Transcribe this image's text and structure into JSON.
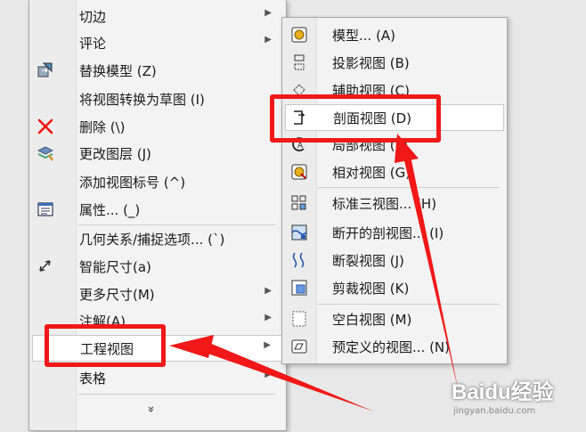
{
  "main_menu": {
    "items": [
      {
        "label": "切边",
        "icon": "",
        "submenu": true
      },
      {
        "label": "评论",
        "icon": "",
        "submenu": true
      },
      {
        "label": "替换模型 (Z)",
        "icon": "replace-model-icon",
        "submenu": false
      },
      {
        "label": "将视图转换为草图 (I)",
        "icon": "",
        "submenu": false
      },
      {
        "label": "删除 (\\)",
        "icon": "delete-x-icon",
        "submenu": false
      },
      {
        "label": "更改图层 (J)",
        "icon": "layers-icon",
        "submenu": false
      },
      {
        "label": "添加视图标号 (^)",
        "icon": "",
        "submenu": false
      },
      {
        "label": "属性... (_)",
        "icon": "properties-icon",
        "submenu": false
      },
      {
        "label": "几何关系/捕捉选项... (`)",
        "icon": "",
        "submenu": false
      },
      {
        "label": "智能尺寸(a)",
        "icon": "smart-dimension-icon",
        "submenu": false
      },
      {
        "label": "更多尺寸(M)",
        "icon": "",
        "submenu": true
      },
      {
        "label": "注解(A)",
        "icon": "",
        "submenu": true
      },
      {
        "label": "工程视图",
        "icon": "",
        "submenu": true
      },
      {
        "label": "表格",
        "icon": "",
        "submenu": true
      }
    ],
    "expand_glyph": "»"
  },
  "sub_menu": {
    "items": [
      {
        "label": "模型... (A)",
        "icon": "model-view-icon"
      },
      {
        "label": "投影视图 (B)",
        "icon": "projected-view-icon"
      },
      {
        "label": "辅助视图 (C)",
        "icon": "auxiliary-view-icon"
      },
      {
        "label": "剖面视图 (D)",
        "icon": "section-view-icon"
      },
      {
        "label": "局部视图 (F)",
        "icon": "detail-view-icon"
      },
      {
        "label": "相对视图 (G)",
        "icon": "relative-view-icon"
      },
      {
        "label": "标准三视图... (H)",
        "icon": "standard-3-view-icon"
      },
      {
        "label": "断开的剖视图... (I)",
        "icon": "broken-out-section-icon"
      },
      {
        "label": "断裂视图 (J)",
        "icon": "break-view-icon"
      },
      {
        "label": "剪裁视图 (K)",
        "icon": "crop-view-icon"
      },
      {
        "label": "空白视图 (M)",
        "icon": "empty-view-icon"
      },
      {
        "label": "预定义的视图... (N)",
        "icon": "predefined-view-icon"
      }
    ]
  },
  "watermark": {
    "brand": "Baidu经验",
    "site": "jingyan.baidu.com"
  },
  "colors": {
    "annotation_red": "#f01818",
    "menu_bg": "#f3f3f3",
    "highlight_bg": "#ffffff"
  }
}
